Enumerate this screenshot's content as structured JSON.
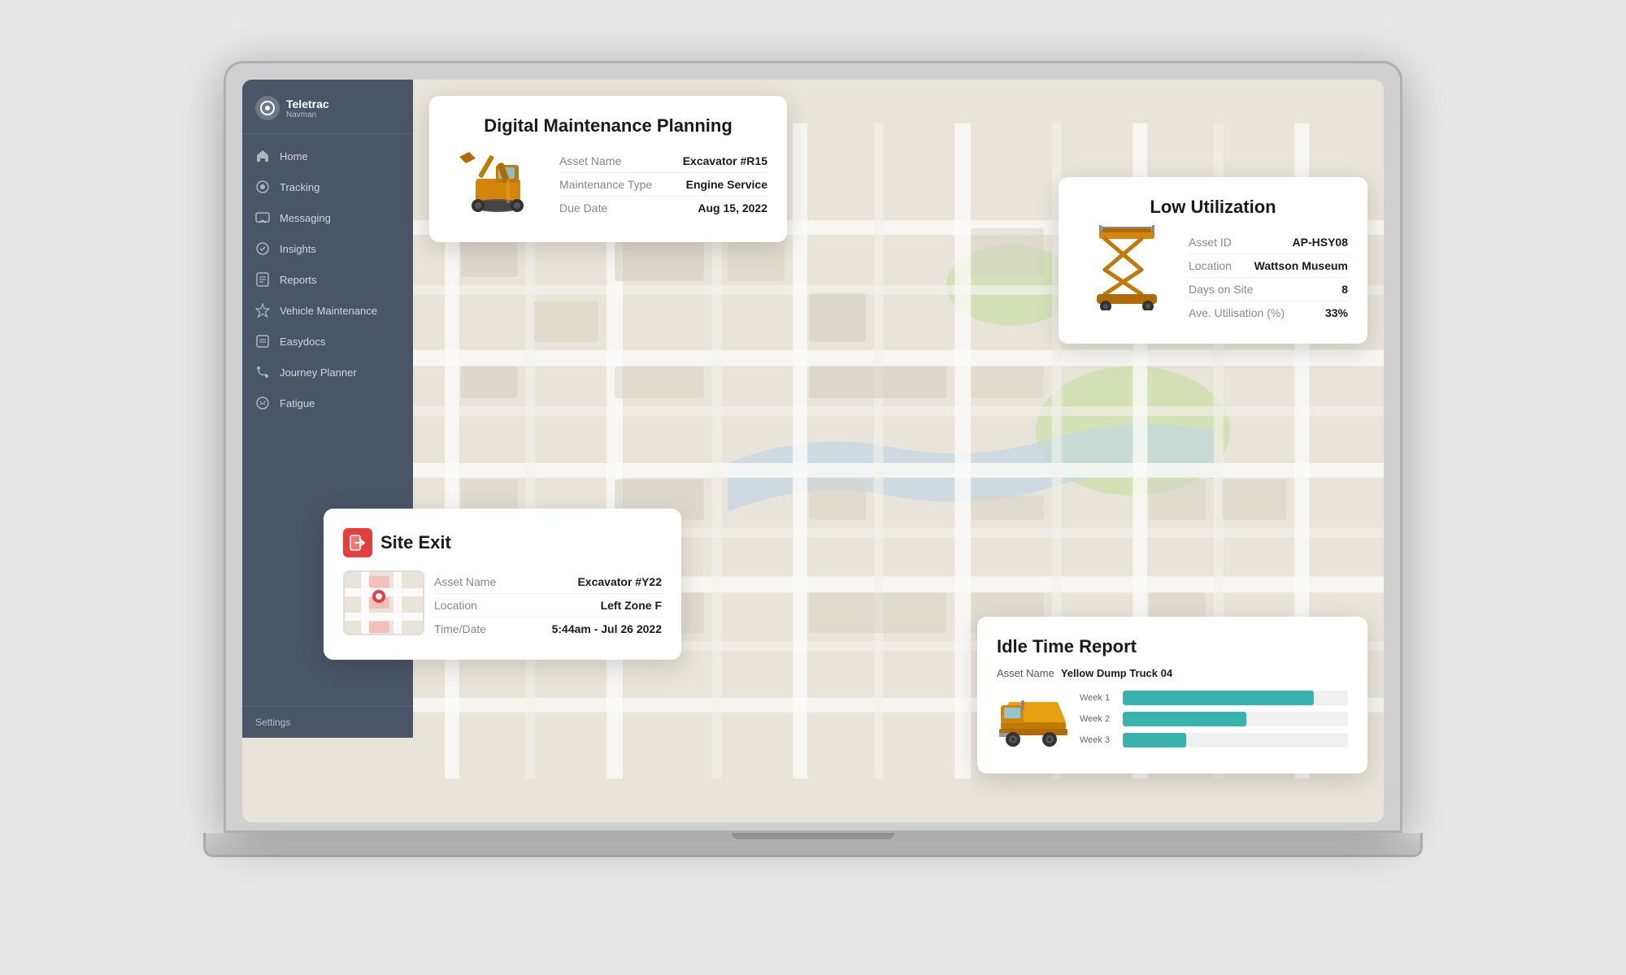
{
  "app": {
    "name": "Teletrac",
    "tagline": "Navman"
  },
  "sidebar": {
    "logo_icon": "◎",
    "items": [
      {
        "label": "Home",
        "icon": "home"
      },
      {
        "label": "Tracking",
        "icon": "tracking"
      },
      {
        "label": "Messaging",
        "icon": "messaging"
      },
      {
        "label": "Insights",
        "icon": "insights"
      },
      {
        "label": "Reports",
        "icon": "reports"
      },
      {
        "label": "Vehicle Maintenance",
        "icon": "maintenance"
      },
      {
        "label": "Easydocs",
        "icon": "easydocs"
      },
      {
        "label": "Journey Planner",
        "icon": "journey"
      },
      {
        "label": "Fatigue",
        "icon": "fatigue"
      }
    ],
    "settings_label": "Settings"
  },
  "maintenance_card": {
    "title": "Digital Maintenance Planning",
    "asset_name_label": "Asset Name",
    "asset_name_value": "Excavator #R15",
    "maintenance_type_label": "Maintenance Type",
    "maintenance_type_value": "Engine Service",
    "due_date_label": "Due Date",
    "due_date_value": "Aug 15, 2022"
  },
  "utilization_card": {
    "title": "Low Utilization",
    "asset_id_label": "Asset ID",
    "asset_id_value": "AP-HSY08",
    "location_label": "Location",
    "location_value": "Wattson Museum",
    "days_label": "Days on Site",
    "days_value": "8",
    "utilisation_label": "Ave. Utilisation (%)",
    "utilisation_value": "33%"
  },
  "site_exit_card": {
    "title": "Site Exit",
    "asset_name_label": "Asset Name",
    "asset_name_value": "Excavator #Y22",
    "location_label": "Location",
    "location_value": "Left Zone F",
    "time_label": "Time/Date",
    "time_value": "5:44am - Jul 26 2022"
  },
  "idle_time_card": {
    "title": "Idle Time Report",
    "asset_name_label": "Asset Name",
    "asset_name_value": "Yellow Dump Truck 04",
    "bars": [
      {
        "label": "Week 1",
        "pct": 85
      },
      {
        "label": "Week 2",
        "pct": 55
      },
      {
        "label": "Week 3",
        "pct": 28
      }
    ]
  }
}
